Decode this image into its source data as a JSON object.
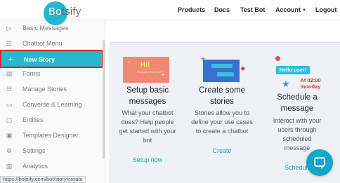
{
  "brand": {
    "logo_prefix": "Bo",
    "logo_rest": "tsify"
  },
  "nav": {
    "products": "Products",
    "docs": "Docs",
    "test_bot": "Test Bot",
    "account": "Account",
    "logout": "Logout"
  },
  "sidebar": {
    "items": [
      {
        "label": "Basic Messages",
        "icon": "play-icon"
      },
      {
        "label": "Chatbot Menu",
        "icon": "menu-icon"
      },
      {
        "label": "New Story",
        "icon": "plus-icon",
        "active": true
      },
      {
        "label": "Forms",
        "icon": "form-icon"
      },
      {
        "label": "Manage Stories",
        "icon": "list-icon"
      },
      {
        "label": "Converse & Learning",
        "icon": "chat-icon"
      },
      {
        "label": "Entities",
        "icon": "entities-icon"
      },
      {
        "label": "Templates Designer",
        "icon": "template-icon"
      },
      {
        "label": "Settings",
        "icon": "gear-icon"
      },
      {
        "label": "Analytics",
        "icon": "analytics-icon"
      }
    ]
  },
  "statusbar": {
    "url": "https://botsify.com/bot/story/create"
  },
  "cards": [
    {
      "title": "Setup basic messages",
      "desc": "What your chatbot does? Help people get started with your bot",
      "link": "Setup now",
      "illustration": {
        "hi": "Hi!",
        "tiny": "How can I help you?"
      }
    },
    {
      "title": "Create some stories",
      "desc": "Stories allow you to define your use cases to create a chatbot",
      "link": "Create"
    },
    {
      "title": "Schedule a message",
      "desc": "Interact with your users through scheduled message",
      "link": "Schedul",
      "illustration": {
        "hello": "Hello user!",
        "time": "At 02:00 monday"
      }
    }
  ],
  "colors": {
    "accent": "#29b6d1",
    "active_border": "#d9252a",
    "link": "#1aa0be"
  }
}
